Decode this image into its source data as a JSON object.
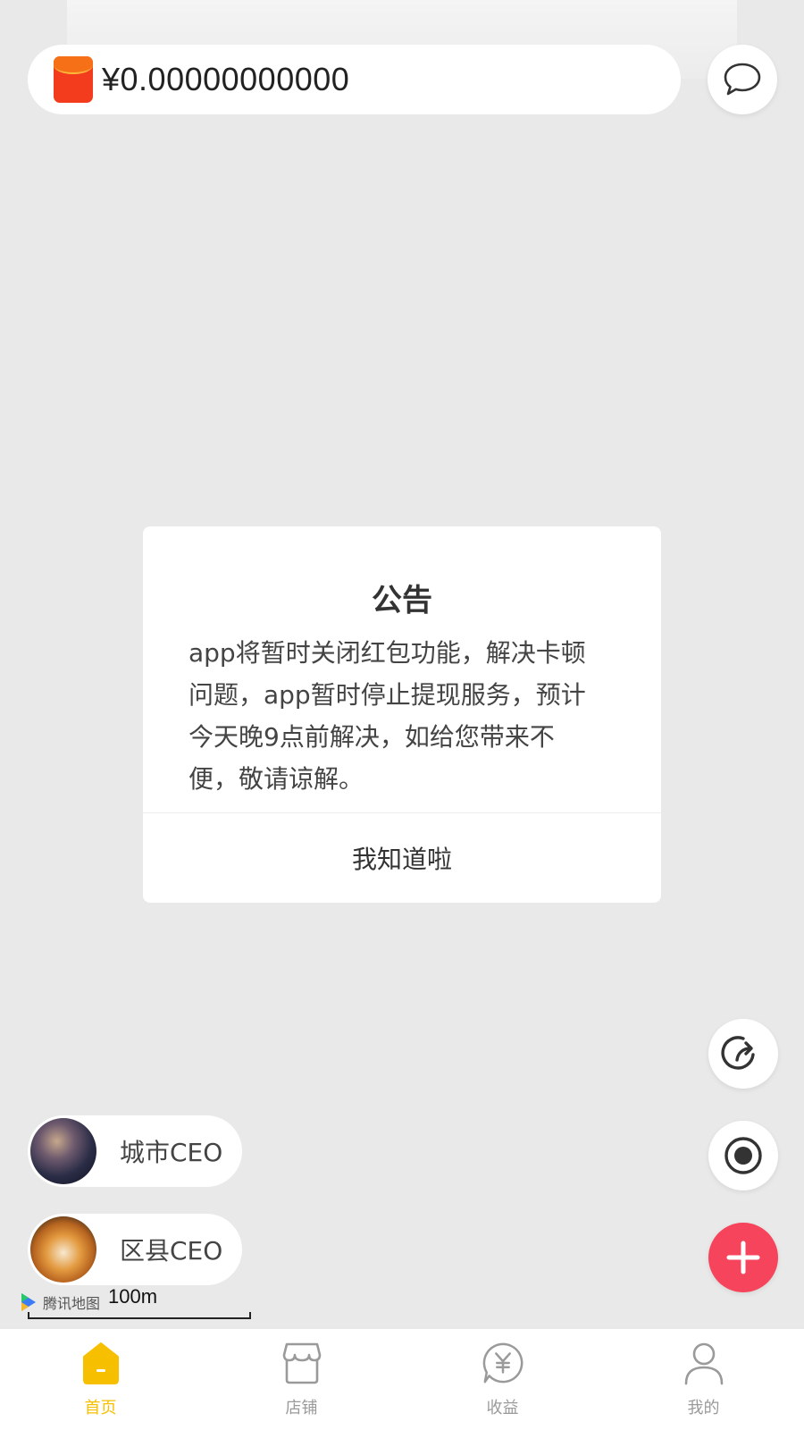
{
  "balance": {
    "amount": "¥0.00000000000"
  },
  "dialog": {
    "title": "公告",
    "lines": [
      "app将暂时关闭红包功能，解决卡顿",
      "问题，app暂时停止提现服务，预计",
      "今天晚9点前解决，如给您带来不",
      "便，敬请谅解。"
    ],
    "confirm_label": "我知道啦"
  },
  "ceo": {
    "city_label": "城市CEO",
    "county_label": "区县CEO"
  },
  "map": {
    "logo_text": "腾讯地图",
    "scale": "100m"
  },
  "tabs": [
    {
      "label": "首页",
      "icon": "home-tag-icon",
      "active": true
    },
    {
      "label": "店铺",
      "icon": "store-icon",
      "active": false
    },
    {
      "label": "收益",
      "icon": "yuan-chat-icon",
      "active": false
    },
    {
      "label": "我的",
      "icon": "user-icon",
      "active": false
    }
  ],
  "colors": {
    "accent": "#f6c000",
    "add_button": "#f5445b",
    "red_packet": "#f33c1d"
  }
}
